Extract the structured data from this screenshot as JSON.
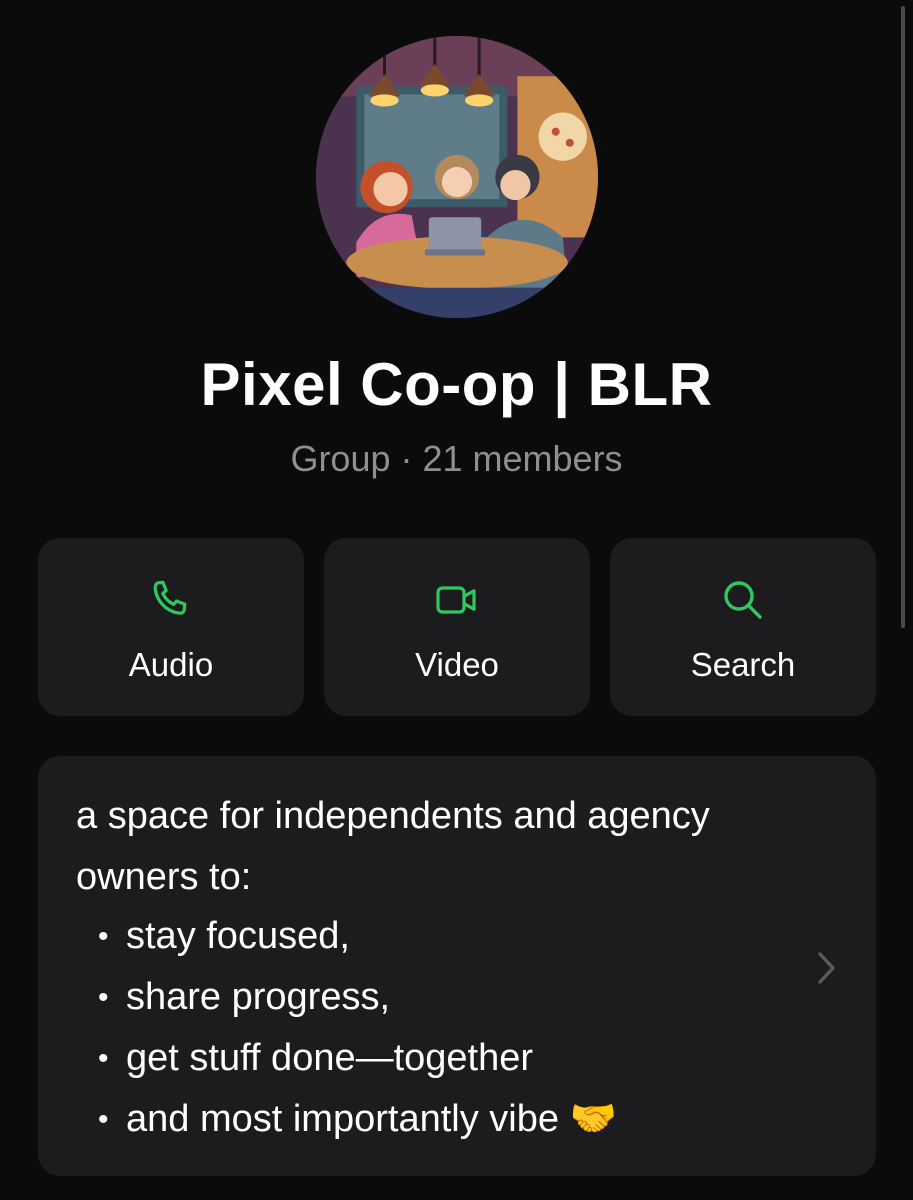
{
  "group": {
    "title": "Pixel Co-op | BLR",
    "subtitle": "Group · 21 members"
  },
  "actions": [
    {
      "label": "Audio",
      "icon": "phone-icon"
    },
    {
      "label": "Video",
      "icon": "video-camera-icon"
    },
    {
      "label": "Search",
      "icon": "search-icon"
    }
  ],
  "about": {
    "intro": "a space for independents and agency owners to:",
    "bullets": [
      "stay focused,",
      "share progress,",
      "get stuff done—together",
      "and most importantly vibe 🤝"
    ]
  },
  "colors": {
    "background": "#0b0b0b",
    "card": "#1c1c1e",
    "accent": "#31c75f",
    "secondary_text": "#8e8e93"
  }
}
